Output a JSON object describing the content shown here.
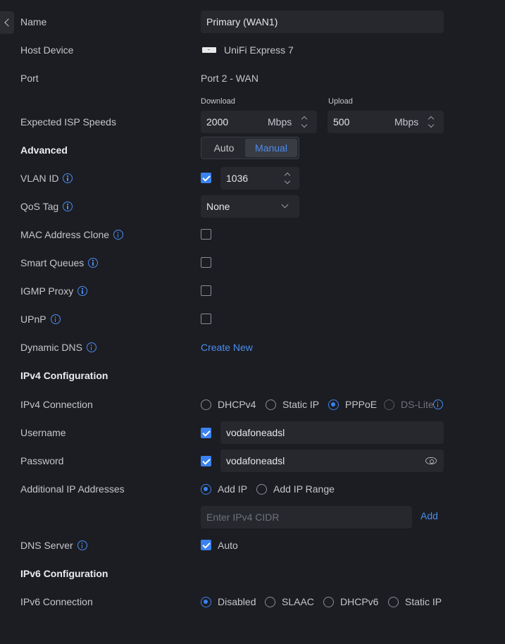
{
  "name": {
    "label": "Name",
    "value": "Primary (WAN1)"
  },
  "host_device": {
    "label": "Host Device",
    "value": "UniFi Express 7",
    "icon": "router-device-icon"
  },
  "port": {
    "label": "Port",
    "value": "Port 2 - WAN"
  },
  "speeds": {
    "label": "Expected ISP Speeds",
    "download_label": "Download",
    "download_value": "2000",
    "download_unit": "Mbps",
    "upload_label": "Upload",
    "upload_value": "500",
    "upload_unit": "Mbps"
  },
  "advanced": {
    "label": "Advanced",
    "options": [
      "Auto",
      "Manual"
    ],
    "selected": "Manual"
  },
  "vlan": {
    "label": "VLAN ID",
    "enabled": true,
    "value": "1036"
  },
  "qos": {
    "label": "QoS Tag",
    "value": "None"
  },
  "mac_clone": {
    "label": "MAC Address Clone",
    "checked": false
  },
  "smart_queues": {
    "label": "Smart Queues",
    "checked": false
  },
  "igmp": {
    "label": "IGMP Proxy",
    "checked": false
  },
  "upnp": {
    "label": "UPnP",
    "checked": false
  },
  "ddns": {
    "label": "Dynamic DNS",
    "action": "Create New"
  },
  "ipv4": {
    "section_label": "IPv4 Configuration",
    "connection_label": "IPv4 Connection",
    "options": [
      "DHCPv4",
      "Static IP",
      "PPPoE",
      "DS-Lite"
    ],
    "selected": "PPPoE"
  },
  "username": {
    "label": "Username",
    "checked": true,
    "value": "vodafoneadsl"
  },
  "password": {
    "label": "Password",
    "checked": true,
    "value": "vodafoneadsl"
  },
  "additional_ip": {
    "label": "Additional IP Addresses",
    "options": [
      "Add IP",
      "Add IP Range"
    ],
    "selected": "Add IP",
    "placeholder": "Enter IPv4 CIDR",
    "add_label": "Add"
  },
  "dns": {
    "label": "DNS Server",
    "checked": true,
    "value": "Auto"
  },
  "ipv6": {
    "section_label": "IPv6 Configuration",
    "connection_label": "IPv6 Connection",
    "options": [
      "Disabled",
      "SLAAC",
      "DHCPv6",
      "Static IP"
    ],
    "selected": "Disabled"
  },
  "colors": {
    "background": "#1c1d22",
    "accent": "#3b82f0",
    "field": "#26282e",
    "text": "#c4c6cc"
  }
}
